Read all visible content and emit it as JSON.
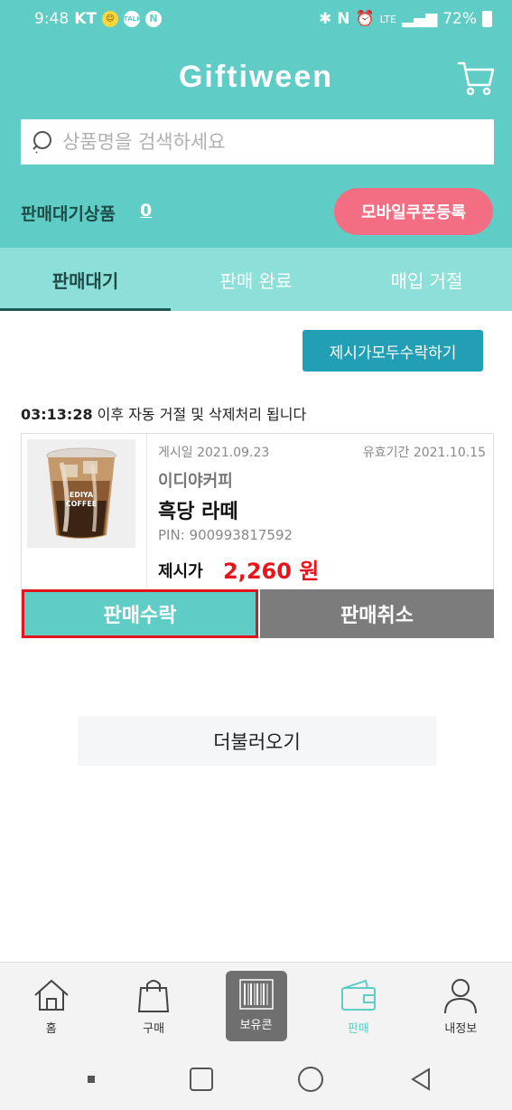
{
  "status_bar": {
    "time": "9:48",
    "carrier": "KT",
    "talk_label": "TALK",
    "n_label": "N",
    "lte_label": "LTE",
    "battery": "72%"
  },
  "header": {
    "title": "Giftiween",
    "search_placeholder": "상품명을 검색하세요",
    "pending_label": "판매대기상품",
    "pending_count": "0",
    "register_button": "모바일쿠폰등록"
  },
  "tabs": [
    {
      "label": "판매대기",
      "active": true
    },
    {
      "label": "판매 완료",
      "active": false
    },
    {
      "label": "매입 거절",
      "active": false
    }
  ],
  "accept_all_button": "제시가모두수락하기",
  "notice": {
    "time": "03:13:28",
    "text": " 이후 자동 거절 및 삭제처리 됩니다"
  },
  "product": {
    "posted_label": "게시일",
    "posted_date": "2021.09.23",
    "expiry_label": "유효기간",
    "expiry_date": "2021.10.15",
    "brand": "이디야커피",
    "name": "흑당 라떼",
    "pin_label": "PIN:",
    "pin": "900993817592",
    "offer_label": "제시가",
    "offer_price": "2,260 원",
    "cup_text_1": "EDIYA",
    "cup_text_2": "COFFEE",
    "accept_button": "판매수락",
    "cancel_button": "판매취소"
  },
  "load_more_button": "더불러오기",
  "bottom_nav": [
    {
      "label": "홈",
      "icon": "home-icon"
    },
    {
      "label": "구매",
      "icon": "shopping-bag-icon"
    },
    {
      "label": "보유콘",
      "icon": "barcode-icon"
    },
    {
      "label": "판매",
      "icon": "wallet-icon"
    },
    {
      "label": "내정보",
      "icon": "person-icon"
    }
  ],
  "colors": {
    "accent": "#5fcdc5",
    "tab_bg": "#8ddfd9",
    "register": "#f46e83",
    "accept_all": "#229fb4",
    "price": "#e8131b",
    "highlight_border": "#e3141c",
    "cancel": "#7c7c7c"
  }
}
